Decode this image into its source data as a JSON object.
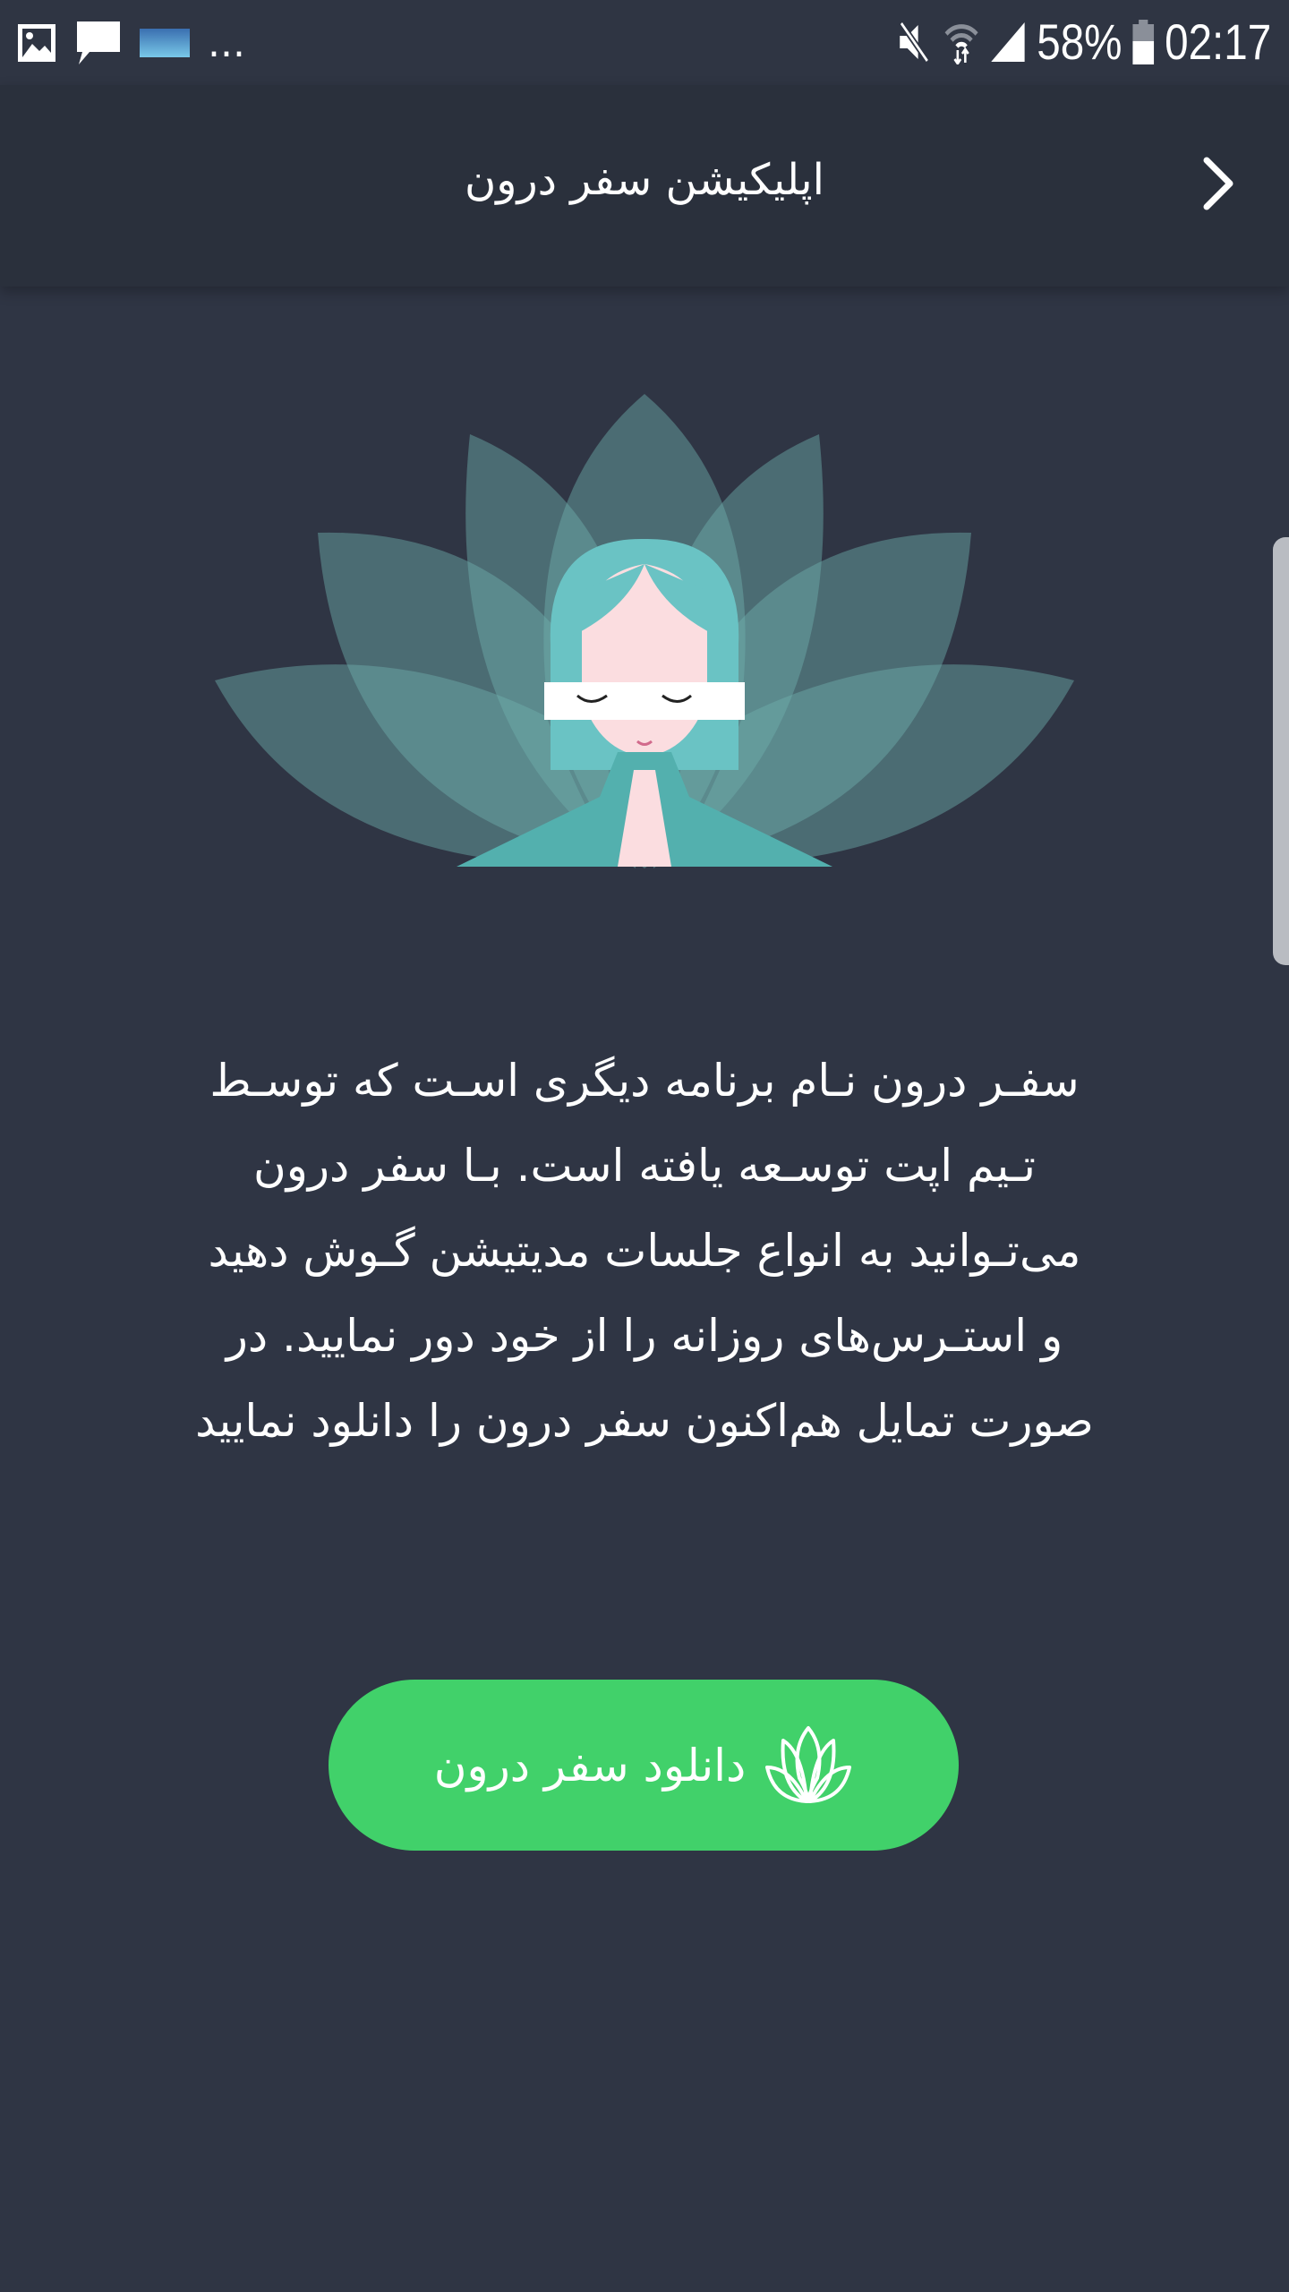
{
  "status_bar": {
    "battery": "58%",
    "time": "02:17",
    "overflow": "...",
    "icons": [
      "image-icon",
      "message-icon",
      "app-thumbnail-icon",
      "mute-icon",
      "wifi-icon",
      "signal-icon",
      "battery-icon"
    ]
  },
  "app_bar": {
    "title": "اپلیکیشن سفر درون",
    "back_icon": "chevron-right-icon"
  },
  "description": {
    "lines": [
      "سفـر درون نـام برنامه دیگری اسـت که توسـط",
      "تـیم اپت توسـعه یافته است. بـا سفر درون",
      "می‌تـوانید به انواع جلسات مدیتیشن گـوش دهید",
      "و استـرس‌های روزانه را از خود دور نمایید. در",
      "صورت تمایل هم‌اکنون سفر درون را دانلود نمایید"
    ]
  },
  "download_button": {
    "label": "دانلود سفر درون",
    "icon": "lotus-icon",
    "color": "#41d16a"
  },
  "colors": {
    "background": "#2f3544",
    "app_bar": "#2a303c",
    "accent": "#41d16a"
  }
}
